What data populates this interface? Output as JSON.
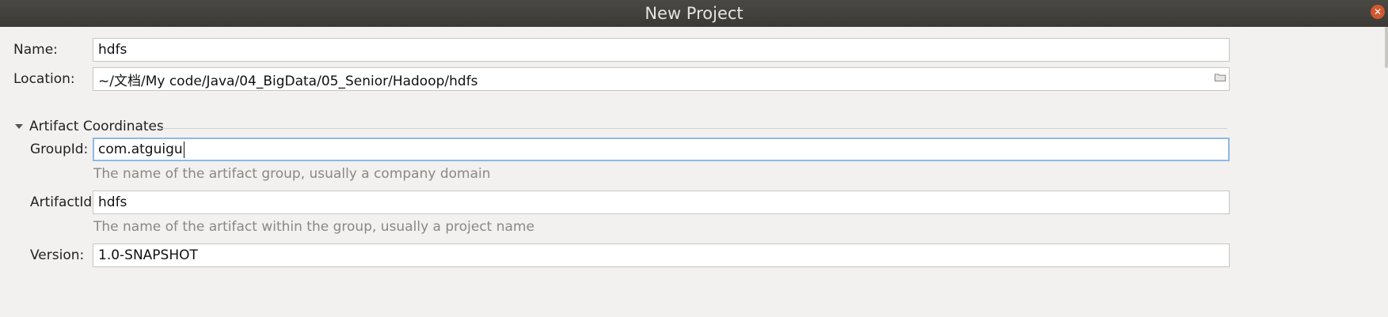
{
  "window": {
    "title": "New Project"
  },
  "form": {
    "name_label": "Name:",
    "name_value": "hdfs",
    "location_label": "Location:",
    "location_value": "~/文档/My code/Java/04_BigData/05_Senior/Hadoop/hdfs"
  },
  "artifact": {
    "section_label": "Artifact Coordinates",
    "groupid_label": "GroupId:",
    "groupid_value": "com.atguigu",
    "groupid_hint": "The name of the artifact group, usually a company domain",
    "artifactid_label": "ArtifactId:",
    "artifactid_value": "hdfs",
    "artifactid_hint": "The name of the artifact within the group, usually a project name",
    "version_label": "Version:",
    "version_value": "1.0-SNAPSHOT"
  },
  "icons": {
    "browse": "folder-icon",
    "expand": "triangle-down-icon",
    "close": "close-icon"
  }
}
